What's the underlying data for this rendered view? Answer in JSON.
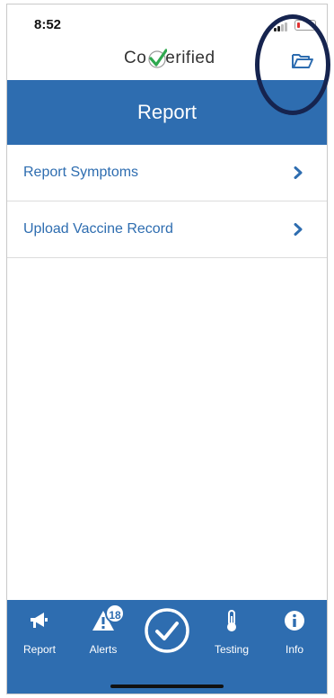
{
  "status_bar": {
    "time": "8:52"
  },
  "header": {
    "logo_prefix": "Co",
    "logo_suffix": "erified"
  },
  "title": "Report",
  "menu": [
    {
      "label": "Report Symptoms"
    },
    {
      "label": "Upload Vaccine Record"
    }
  ],
  "tabs": {
    "report": "Report",
    "alerts": "Alerts",
    "alerts_badge": "18",
    "testing": "Testing",
    "info": "Info"
  },
  "colors": {
    "primary": "#2e6db0",
    "check_green": "#2fa84f",
    "annotation": "#16244f"
  },
  "icons": {
    "folder": "folder-open-icon",
    "chevron": "chevron-right-icon",
    "report": "megaphone-icon",
    "alerts": "alert-triangle-icon",
    "center": "check-circle-icon",
    "testing": "thermometer-icon",
    "info": "info-icon"
  }
}
